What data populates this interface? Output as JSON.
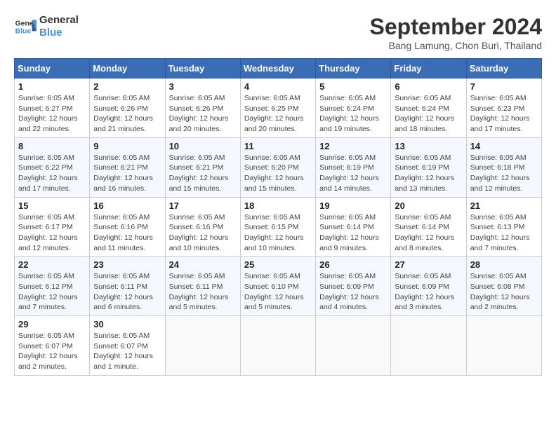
{
  "header": {
    "logo_line1": "General",
    "logo_line2": "Blue",
    "month": "September 2024",
    "location": "Bang Lamung, Chon Buri, Thailand"
  },
  "weekdays": [
    "Sunday",
    "Monday",
    "Tuesday",
    "Wednesday",
    "Thursday",
    "Friday",
    "Saturday"
  ],
  "weeks": [
    [
      {
        "day": "1",
        "sunrise": "6:05 AM",
        "sunset": "6:27 PM",
        "daylight": "12 hours and 22 minutes."
      },
      {
        "day": "2",
        "sunrise": "6:05 AM",
        "sunset": "6:26 PM",
        "daylight": "12 hours and 21 minutes."
      },
      {
        "day": "3",
        "sunrise": "6:05 AM",
        "sunset": "6:26 PM",
        "daylight": "12 hours and 20 minutes."
      },
      {
        "day": "4",
        "sunrise": "6:05 AM",
        "sunset": "6:25 PM",
        "daylight": "12 hours and 20 minutes."
      },
      {
        "day": "5",
        "sunrise": "6:05 AM",
        "sunset": "6:24 PM",
        "daylight": "12 hours and 19 minutes."
      },
      {
        "day": "6",
        "sunrise": "6:05 AM",
        "sunset": "6:24 PM",
        "daylight": "12 hours and 18 minutes."
      },
      {
        "day": "7",
        "sunrise": "6:05 AM",
        "sunset": "6:23 PM",
        "daylight": "12 hours and 17 minutes."
      }
    ],
    [
      {
        "day": "8",
        "sunrise": "6:05 AM",
        "sunset": "6:22 PM",
        "daylight": "12 hours and 17 minutes."
      },
      {
        "day": "9",
        "sunrise": "6:05 AM",
        "sunset": "6:21 PM",
        "daylight": "12 hours and 16 minutes."
      },
      {
        "day": "10",
        "sunrise": "6:05 AM",
        "sunset": "6:21 PM",
        "daylight": "12 hours and 15 minutes."
      },
      {
        "day": "11",
        "sunrise": "6:05 AM",
        "sunset": "6:20 PM",
        "daylight": "12 hours and 15 minutes."
      },
      {
        "day": "12",
        "sunrise": "6:05 AM",
        "sunset": "6:19 PM",
        "daylight": "12 hours and 14 minutes."
      },
      {
        "day": "13",
        "sunrise": "6:05 AM",
        "sunset": "6:19 PM",
        "daylight": "12 hours and 13 minutes."
      },
      {
        "day": "14",
        "sunrise": "6:05 AM",
        "sunset": "6:18 PM",
        "daylight": "12 hours and 12 minutes."
      }
    ],
    [
      {
        "day": "15",
        "sunrise": "6:05 AM",
        "sunset": "6:17 PM",
        "daylight": "12 hours and 12 minutes."
      },
      {
        "day": "16",
        "sunrise": "6:05 AM",
        "sunset": "6:16 PM",
        "daylight": "12 hours and 11 minutes."
      },
      {
        "day": "17",
        "sunrise": "6:05 AM",
        "sunset": "6:16 PM",
        "daylight": "12 hours and 10 minutes."
      },
      {
        "day": "18",
        "sunrise": "6:05 AM",
        "sunset": "6:15 PM",
        "daylight": "12 hours and 10 minutes."
      },
      {
        "day": "19",
        "sunrise": "6:05 AM",
        "sunset": "6:14 PM",
        "daylight": "12 hours and 9 minutes."
      },
      {
        "day": "20",
        "sunrise": "6:05 AM",
        "sunset": "6:14 PM",
        "daylight": "12 hours and 8 minutes."
      },
      {
        "day": "21",
        "sunrise": "6:05 AM",
        "sunset": "6:13 PM",
        "daylight": "12 hours and 7 minutes."
      }
    ],
    [
      {
        "day": "22",
        "sunrise": "6:05 AM",
        "sunset": "6:12 PM",
        "daylight": "12 hours and 7 minutes."
      },
      {
        "day": "23",
        "sunrise": "6:05 AM",
        "sunset": "6:11 PM",
        "daylight": "12 hours and 6 minutes."
      },
      {
        "day": "24",
        "sunrise": "6:05 AM",
        "sunset": "6:11 PM",
        "daylight": "12 hours and 5 minutes."
      },
      {
        "day": "25",
        "sunrise": "6:05 AM",
        "sunset": "6:10 PM",
        "daylight": "12 hours and 5 minutes."
      },
      {
        "day": "26",
        "sunrise": "6:05 AM",
        "sunset": "6:09 PM",
        "daylight": "12 hours and 4 minutes."
      },
      {
        "day": "27",
        "sunrise": "6:05 AM",
        "sunset": "6:09 PM",
        "daylight": "12 hours and 3 minutes."
      },
      {
        "day": "28",
        "sunrise": "6:05 AM",
        "sunset": "6:08 PM",
        "daylight": "12 hours and 2 minutes."
      }
    ],
    [
      {
        "day": "29",
        "sunrise": "6:05 AM",
        "sunset": "6:07 PM",
        "daylight": "12 hours and 2 minutes."
      },
      {
        "day": "30",
        "sunrise": "6:05 AM",
        "sunset": "6:07 PM",
        "daylight": "12 hours and 1 minute."
      },
      null,
      null,
      null,
      null,
      null
    ]
  ],
  "labels": {
    "sunrise": "Sunrise:",
    "sunset": "Sunset:",
    "daylight": "Daylight:"
  }
}
